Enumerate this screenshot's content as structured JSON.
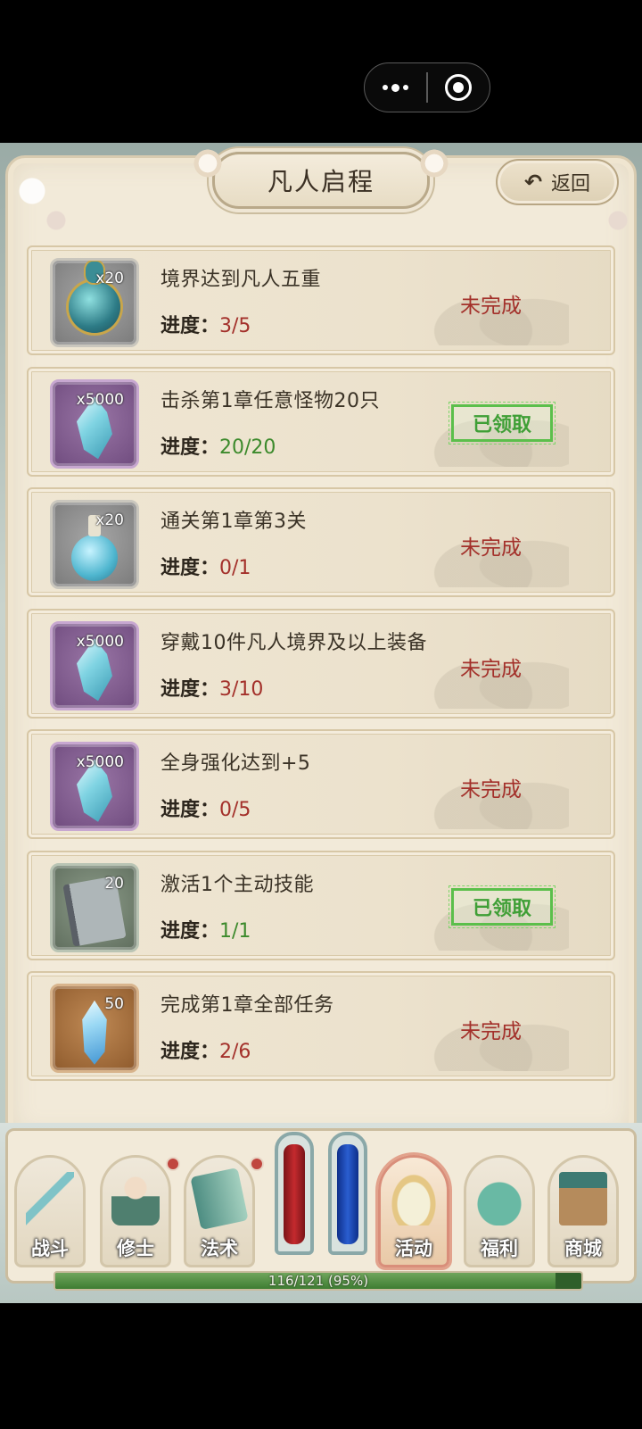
{
  "capsule": {
    "menu_icon": "more-dots-icon",
    "close_icon": "target-circle-icon"
  },
  "header": {
    "title": "凡人启程",
    "back_label": "返回",
    "back_icon": "undo-arrow-icon"
  },
  "tasks": [
    {
      "title": "境界达到凡人五重",
      "progress_label": "进度：",
      "progress": "3/5",
      "quantity": "x20",
      "item_icon": "gourd-icon",
      "bg": "gray",
      "status": "未完成",
      "claimed": false
    },
    {
      "title": "击杀第1章任意怪物20只",
      "progress_label": "进度：",
      "progress": "20/20",
      "quantity": "x5000",
      "item_icon": "crystal-icon",
      "bg": "purple",
      "status": "已领取",
      "claimed": true
    },
    {
      "title": "通关第1章第3关",
      "progress_label": "进度：",
      "progress": "0/1",
      "quantity": "x20",
      "item_icon": "flask-icon",
      "bg": "gray",
      "status": "未完成",
      "claimed": false
    },
    {
      "title": "穿戴10件凡人境界及以上装备",
      "progress_label": "进度：",
      "progress": "3/10",
      "quantity": "x5000",
      "item_icon": "crystal-icon",
      "bg": "purple",
      "status": "未完成",
      "claimed": false
    },
    {
      "title": "全身强化达到+5",
      "progress_label": "进度：",
      "progress": "0/5",
      "quantity": "x5000",
      "item_icon": "crystal-icon",
      "bg": "purple",
      "status": "未完成",
      "claimed": false
    },
    {
      "title": "激活1个主动技能",
      "progress_label": "进度：",
      "progress": "1/1",
      "quantity": "20",
      "item_icon": "skill-book-icon",
      "bg": "green",
      "status": "已领取",
      "claimed": true
    },
    {
      "title": "完成第1章全部任务",
      "progress_label": "进度：",
      "progress": "2/6",
      "quantity": "50",
      "item_icon": "ice-shard-icon",
      "bg": "orange",
      "status": "未完成",
      "claimed": false
    }
  ],
  "nav": [
    {
      "label": "战斗",
      "icon": "sword-icon",
      "badge": false,
      "active": false
    },
    {
      "label": "修士",
      "icon": "cultivator-icon",
      "badge": true,
      "active": false
    },
    {
      "label": "法术",
      "icon": "spellbook-icon",
      "badge": true,
      "active": false
    },
    {
      "label": "活动",
      "icon": "lotus-icon",
      "badge": false,
      "active": true
    },
    {
      "label": "福利",
      "icon": "treasure-bag-icon",
      "badge": false,
      "active": false
    },
    {
      "label": "商城",
      "icon": "shop-stall-icon",
      "badge": false,
      "active": false
    }
  ],
  "vials": {
    "hp_icon": "red-vial-icon",
    "mp_icon": "blue-vial-icon"
  },
  "exp": {
    "text": "116/121 (95%)",
    "fraction": 0.95
  },
  "colors": {
    "incomplete": "#a3302a",
    "complete": "#3c8a2c",
    "claimed_stamp": "#3f9f36",
    "panel": "#f2ead9"
  }
}
